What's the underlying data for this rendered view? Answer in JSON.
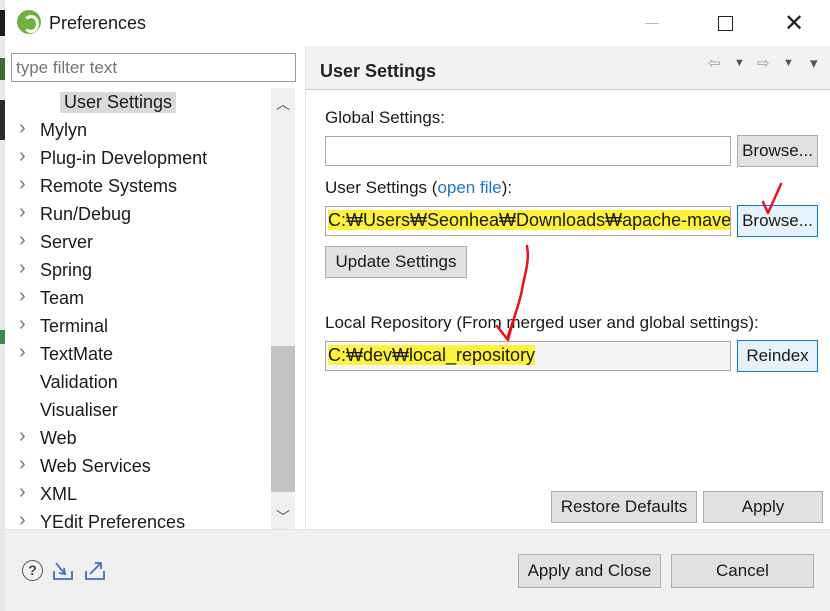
{
  "window": {
    "title": "Preferences",
    "controls": {
      "minimize": "",
      "maximize": "",
      "close": "✕"
    }
  },
  "filter": {
    "placeholder": "type filter text"
  },
  "tree": {
    "items": [
      {
        "label": "User Settings",
        "expandable": false,
        "selected": true
      },
      {
        "label": "Mylyn",
        "expandable": true
      },
      {
        "label": "Plug-in Development",
        "expandable": true
      },
      {
        "label": "Remote Systems",
        "expandable": true
      },
      {
        "label": "Run/Debug",
        "expandable": true
      },
      {
        "label": "Server",
        "expandable": true
      },
      {
        "label": "Spring",
        "expandable": true
      },
      {
        "label": "Team",
        "expandable": true
      },
      {
        "label": "Terminal",
        "expandable": true
      },
      {
        "label": "TextMate",
        "expandable": true
      },
      {
        "label": "Validation",
        "expandable": false
      },
      {
        "label": "Visualiser",
        "expandable": false
      },
      {
        "label": "Web",
        "expandable": true
      },
      {
        "label": "Web Services",
        "expandable": true
      },
      {
        "label": "XML",
        "expandable": true
      },
      {
        "label": "YEdit Preferences",
        "expandable": true
      }
    ],
    "scroll_up_icon": "chevron-up-icon",
    "scroll_down_icon": "chevron-down-icon"
  },
  "page": {
    "title": "User Settings",
    "nav": {
      "back": "⇦",
      "forward": "⇨",
      "dropdown": "▼",
      "menu": "▾"
    },
    "global_settings": {
      "label": "Global Settings:",
      "value": "",
      "browse_label": "Browse..."
    },
    "user_settings": {
      "label_prefix": "User Settings (",
      "link": "open file",
      "label_suffix": "):",
      "value": "C:₩Users₩Seonhea₩Downloads₩apache-maven-",
      "browse_label": "Browse..."
    },
    "update_label": "Update Settings",
    "local_repository": {
      "label": "Local Repository (From merged user and global settings):",
      "value": "C:₩dev₩local_repository",
      "reindex_label": "Reindex"
    },
    "restore_defaults_label": "Restore Defaults",
    "apply_label": "Apply"
  },
  "footer": {
    "help_icon": "help-icon",
    "import_icon": "import-icon",
    "export_icon": "export-icon",
    "help_glyph": "?",
    "apply_close_label": "Apply and Close",
    "cancel_label": "Cancel"
  },
  "colors": {
    "highlight": "#fff23a",
    "annotation": "#e8141b",
    "link": "#1b75c9",
    "focus_border": "#0078d7"
  }
}
